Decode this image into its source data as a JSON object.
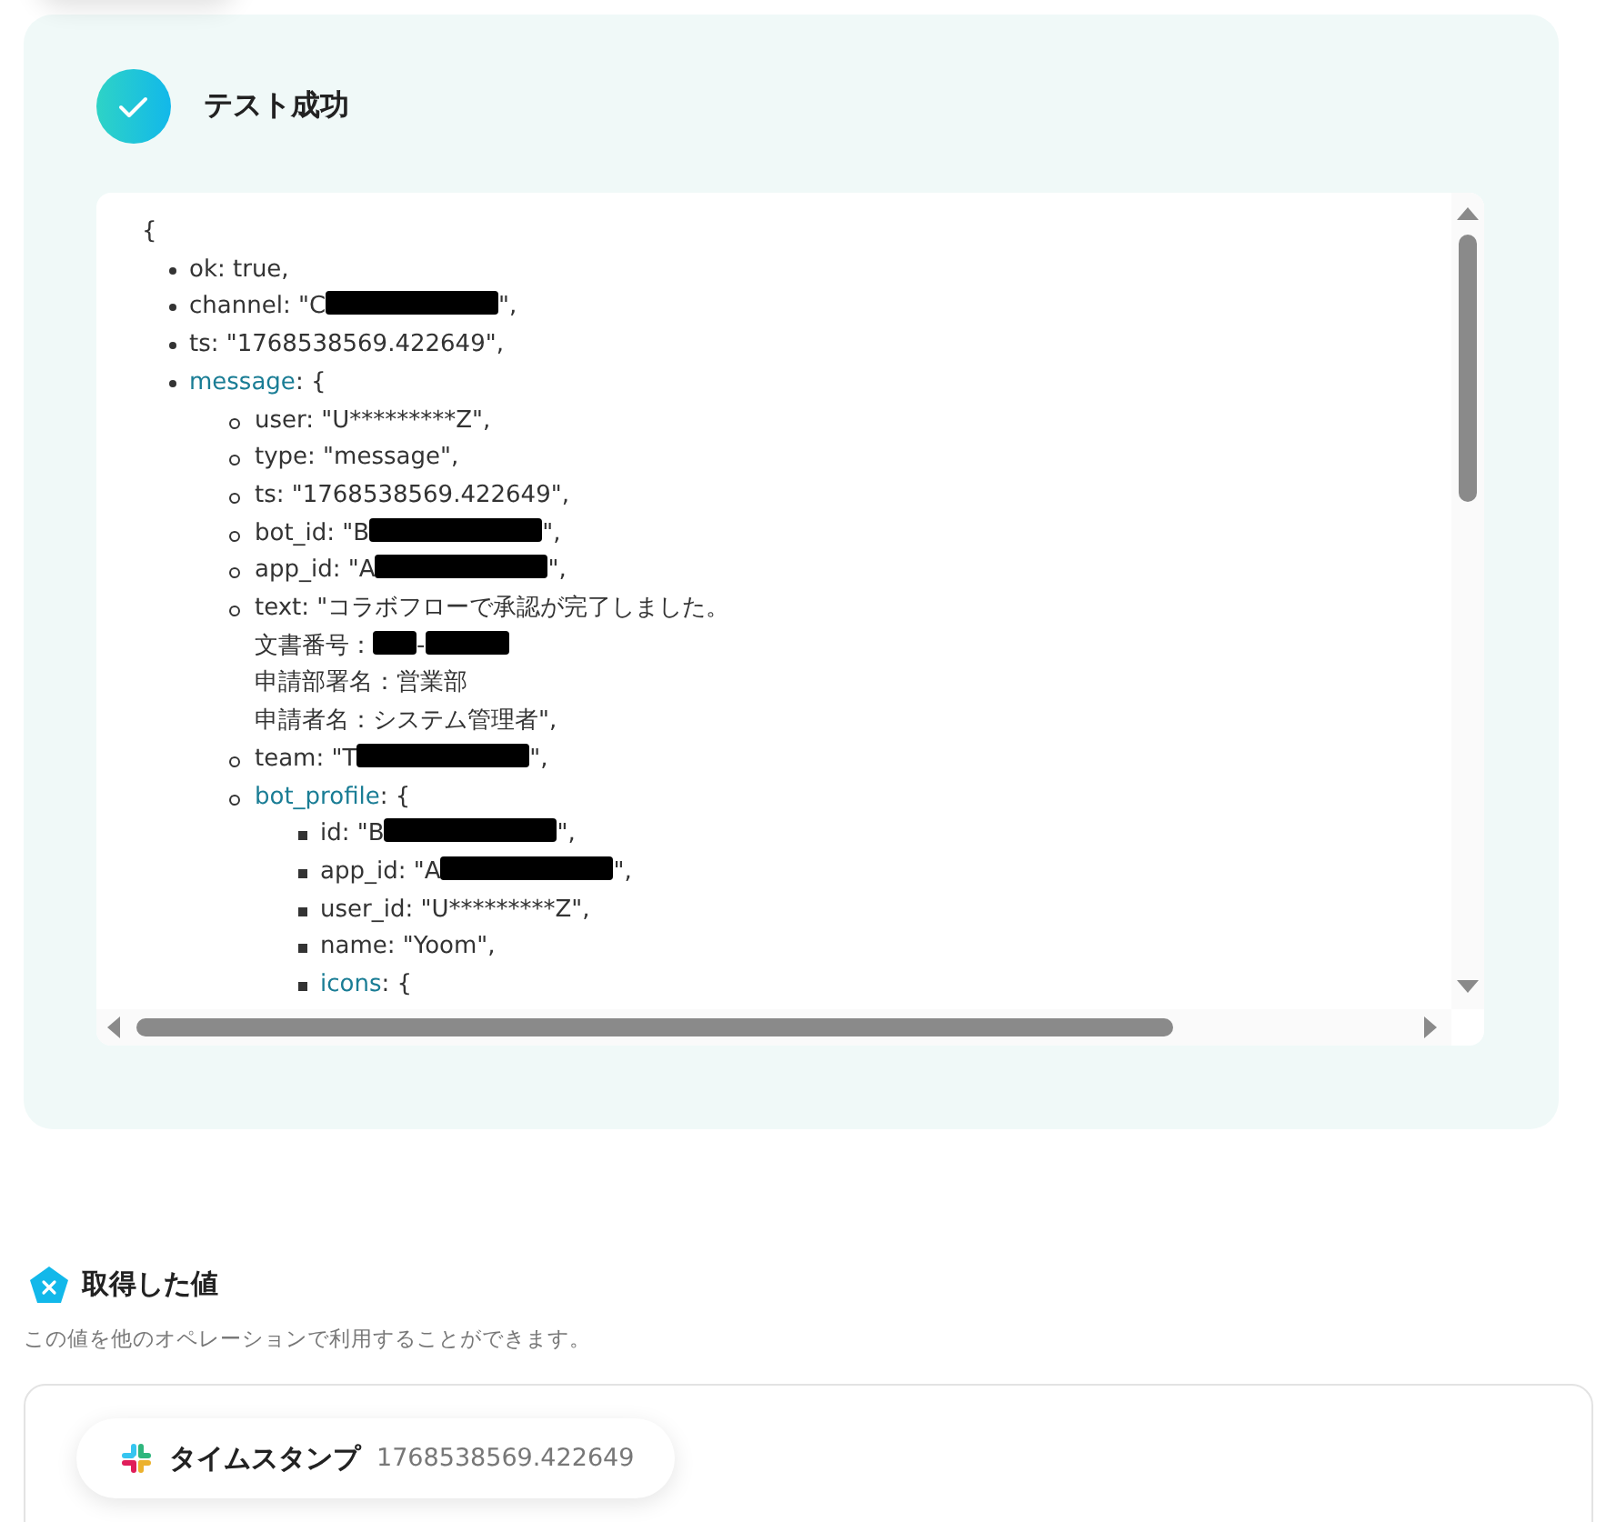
{
  "result": {
    "title": "テスト成功",
    "success": true,
    "open_brace": "{",
    "items": [
      {
        "kind": "field",
        "key": "ok",
        "value": [
          {
            "kind": "text",
            "text": ": true,"
          }
        ]
      },
      {
        "kind": "field",
        "key": "channel",
        "value": [
          {
            "kind": "text",
            "text": ": \"C"
          },
          {
            "kind": "redacted"
          },
          {
            "kind": "text",
            "text": "\","
          }
        ]
      },
      {
        "kind": "field",
        "key": "ts",
        "value": [
          {
            "kind": "text",
            "text": ": \"1768538569.422649\","
          }
        ]
      },
      {
        "kind": "object",
        "key": "message",
        "value": [
          {
            "kind": "text",
            "text": ": {"
          }
        ],
        "children": [
          {
            "kind": "field",
            "key": "user",
            "value": [
              {
                "kind": "text",
                "text": ": \"U*********Z\","
              }
            ]
          },
          {
            "kind": "field",
            "key": "type",
            "value": [
              {
                "kind": "text",
                "text": ": \"message\","
              }
            ]
          },
          {
            "kind": "field",
            "key": "ts",
            "value": [
              {
                "kind": "text",
                "text": ": \"1768538569.422649\","
              }
            ]
          },
          {
            "kind": "field",
            "key": "bot_id",
            "value": [
              {
                "kind": "text",
                "text": ": \"B"
              },
              {
                "kind": "redacted"
              },
              {
                "kind": "text",
                "text": "\","
              }
            ]
          },
          {
            "kind": "field",
            "key": "app_id",
            "value": [
              {
                "kind": "text",
                "text": ": \"A"
              },
              {
                "kind": "redacted"
              },
              {
                "kind": "text",
                "text": "\","
              }
            ]
          },
          {
            "kind": "field",
            "key": "text",
            "value": [
              {
                "kind": "text",
                "text": ": \"コラボフローで承認が完了しました。"
              },
              {
                "kind": "break"
              },
              {
                "kind": "text",
                "text": "文書番号："
              },
              {
                "kind": "redacted_short"
              },
              {
                "kind": "text",
                "text": "-"
              },
              {
                "kind": "redacted_medium"
              },
              {
                "kind": "break"
              },
              {
                "kind": "text",
                "text": "申請部署名：営業部"
              },
              {
                "kind": "break"
              },
              {
                "kind": "text",
                "text": "申請者名：システム管理者\","
              }
            ]
          },
          {
            "kind": "field",
            "key": "team",
            "value": [
              {
                "kind": "text",
                "text": ": \"T"
              },
              {
                "kind": "redacted"
              },
              {
                "kind": "text",
                "text": "\","
              }
            ]
          },
          {
            "kind": "object",
            "key": "bot_profile",
            "value": [
              {
                "kind": "text",
                "text": ": {"
              }
            ],
            "children": [
              {
                "kind": "field",
                "key": "id",
                "value": [
                  {
                    "kind": "text",
                    "text": ": \"B"
                  },
                  {
                    "kind": "redacted"
                  },
                  {
                    "kind": "text",
                    "text": "\","
                  }
                ]
              },
              {
                "kind": "field",
                "key": "app_id",
                "value": [
                  {
                    "kind": "text",
                    "text": ": \"A"
                  },
                  {
                    "kind": "redacted"
                  },
                  {
                    "kind": "text",
                    "text": "\","
                  }
                ]
              },
              {
                "kind": "field",
                "key": "user_id",
                "value": [
                  {
                    "kind": "text",
                    "text": ": \"U*********Z\","
                  }
                ]
              },
              {
                "kind": "field",
                "key": "name",
                "value": [
                  {
                    "kind": "text",
                    "text": ": \"Yoom\","
                  }
                ]
              },
              {
                "kind": "object",
                "key": "icons",
                "value": [
                  {
                    "kind": "text",
                    "text": ": {"
                  }
                ]
              }
            ]
          }
        ]
      }
    ]
  },
  "values": {
    "title": "取得した値",
    "description": "この値を他のオペレーションで利用することができます。",
    "chips": [
      {
        "label": "タイムスタンプ",
        "value": "1768538569.422649"
      }
    ]
  }
}
